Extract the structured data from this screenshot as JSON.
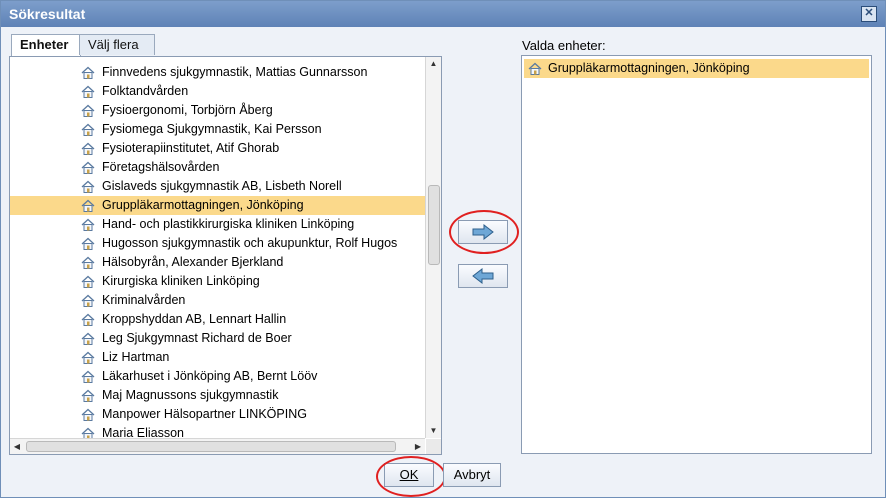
{
  "window": {
    "title": "Sökresultat"
  },
  "tabs": [
    {
      "label": "Enheter",
      "active": true
    },
    {
      "label": "Välj flera",
      "active": false
    }
  ],
  "list": {
    "items": [
      "Finnvedens sjukgymnastik, Mattias Gunnarsson",
      "Folktandvården",
      "Fysioergonomi, Torbjörn Åberg",
      "Fysiomega Sjukgymnastik, Kai Persson",
      "Fysioterapiinstitutet, Atif Ghorab",
      "Företagshälsovården",
      "Gislaveds sjukgymnastik AB, Lisbeth Norell",
      "Gruppläkarmottagningen, Jönköping",
      "Hand- och plastikkirurgiska kliniken Linköping",
      "Hugosson sjukgymnastik och akupunktur, Rolf Hugos",
      "Hälsobyrån, Alexander Bjerkland",
      "Kirurgiska kliniken Linköping",
      "Kriminalvården",
      "Kroppshyddan AB, Lennart Hallin",
      "Leg Sjukgymnast Richard de Boer",
      "Liz Hartman",
      "Läkarhuset i Jönköping AB, Bernt Lööv",
      "Maj Magnussons sjukgymnastik",
      "Manpower Hälsopartner LINKÖPING",
      "Maria Eliasson"
    ],
    "selected_index": 7
  },
  "selected_panel": {
    "label": "Valda enheter:",
    "items": [
      "Gruppläkarmottagningen, Jönköping"
    ]
  },
  "buttons": {
    "ok_label": "OK",
    "cancel_label": "Avbryt"
  },
  "icons": {
    "unit": "house-icon",
    "add": "arrow-right-icon",
    "remove": "arrow-left-icon",
    "close": "close-icon"
  },
  "colors": {
    "selection": "#fbd98b",
    "highlight_ring": "#e02020",
    "arrow": "#6ea7d6"
  }
}
